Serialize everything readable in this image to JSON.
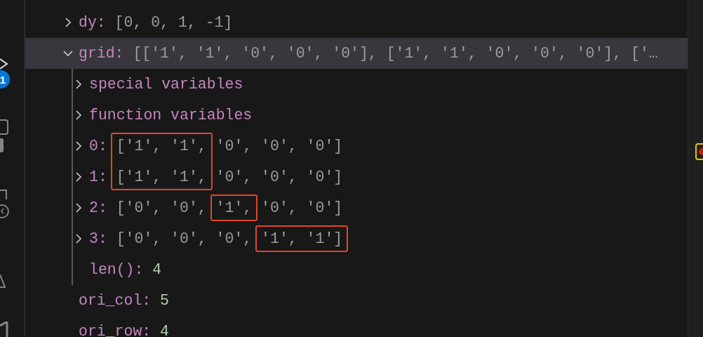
{
  "activity_bar": {
    "badge": "1"
  },
  "variables": [
    {
      "name": "dy:",
      "value": "[0, 0, 1, -1]",
      "kind": "plain",
      "expanded": false,
      "selected": false
    },
    {
      "name": "grid:",
      "value": "[['1', '1', '0', '0', '0'], ['1', '1', '0', '0', '0'], ['…",
      "kind": "plain",
      "expanded": true,
      "selected": true,
      "children": [
        {
          "name": "special variables",
          "expanded": false
        },
        {
          "name": "function variables",
          "expanded": false
        },
        {
          "name": "0:",
          "expanded": false,
          "tokens": [
            {
              "text": "['1',",
              "boxed": true
            },
            {
              "text": "'1',",
              "boxed": true
            },
            {
              "text": "'0',",
              "boxed": false
            },
            {
              "text": "'0',",
              "boxed": false
            },
            {
              "text": "'0']",
              "boxed": false
            }
          ]
        },
        {
          "name": "1:",
          "expanded": false,
          "tokens": [
            {
              "text": "['1',",
              "boxed": true
            },
            {
              "text": "'1',",
              "boxed": true
            },
            {
              "text": "'0',",
              "boxed": false
            },
            {
              "text": "'0',",
              "boxed": false
            },
            {
              "text": "'0']",
              "boxed": false
            }
          ]
        },
        {
          "name": "2:",
          "expanded": false,
          "tokens": [
            {
              "text": "['0',",
              "boxed": false
            },
            {
              "text": "'0',",
              "boxed": false
            },
            {
              "text": "'1',",
              "boxed": true
            },
            {
              "text": "'0',",
              "boxed": false
            },
            {
              "text": "'0']",
              "boxed": false
            }
          ]
        },
        {
          "name": "3:",
          "expanded": false,
          "tokens": [
            {
              "text": "['0',",
              "boxed": false
            },
            {
              "text": "'0',",
              "boxed": false
            },
            {
              "text": "'0',",
              "boxed": false
            },
            {
              "text": "'1',",
              "boxed": true
            },
            {
              "text": "'1']",
              "boxed": true
            }
          ]
        },
        {
          "name": "len():",
          "value": "4",
          "kind": "number"
        }
      ]
    },
    {
      "name": "ori_col:",
      "value": "5",
      "kind": "number"
    },
    {
      "name": "ori_row:",
      "value": "4",
      "kind": "number"
    }
  ]
}
